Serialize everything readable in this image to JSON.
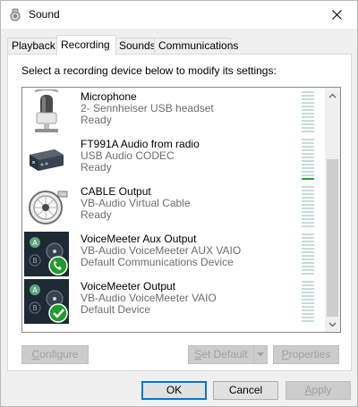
{
  "window": {
    "title": "Sound"
  },
  "tabs": [
    {
      "label": "Playback"
    },
    {
      "label": "Recording"
    },
    {
      "label": "Sounds"
    },
    {
      "label": "Communications"
    }
  ],
  "recording": {
    "instruction": "Select a recording device below to modify its settings:",
    "devices": [
      {
        "name": "Microphone",
        "description": "2- Sennheiser USB headset",
        "status": "Ready",
        "icon": "microphone-icon",
        "level": 0
      },
      {
        "name": "FT991A Audio from radio",
        "description": "USB Audio CODEC",
        "status": "Ready",
        "icon": "sound-card-icon",
        "level": 0.09
      },
      {
        "name": "CABLE Output",
        "description": "VB-Audio Virtual Cable",
        "status": "Ready",
        "icon": "cable-icon",
        "level": 0
      },
      {
        "name": "VoiceMeeter Aux Output",
        "description": "VB-Audio VoiceMeeter AUX VAIO",
        "status": "Default Communications Device",
        "icon": "voicemeeter-phone-icon",
        "level": 0
      },
      {
        "name": "VoiceMeeter Output",
        "description": "VB-Audio VoiceMeeter VAIO",
        "status": "Default Device",
        "icon": "voicemeeter-check-icon",
        "level": 0
      }
    ],
    "buttons": {
      "configure": "Configure",
      "set_default": "Set Default",
      "properties": "Properties"
    }
  },
  "footer": {
    "ok": "OK",
    "cancel": "Cancel",
    "apply": "Apply"
  },
  "colors": {
    "accent": "#0078d7",
    "meter_on": "#27a436",
    "meter_off": "#c8dcd9",
    "check_badge": "#1f9b2c"
  }
}
